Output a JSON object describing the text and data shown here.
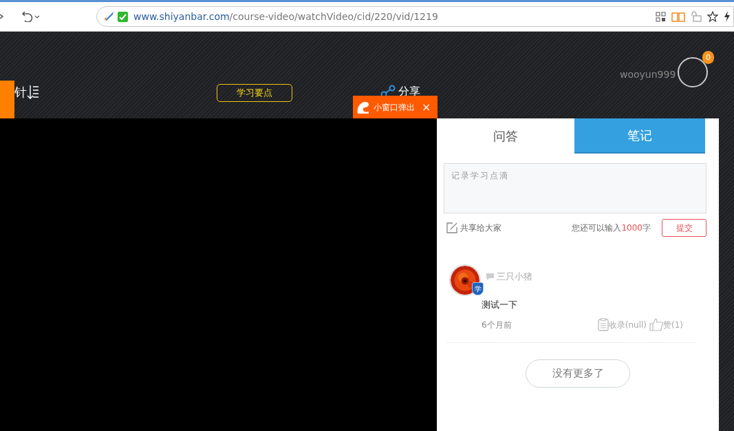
{
  "browser": {
    "url_domain": "www.shiyanbar.com",
    "url_path": "/course-video/watchVideo/cid/220/vid/1219"
  },
  "header": {
    "menu_label": "针",
    "key_points_button": "学习要点",
    "share_label": "分享",
    "username": "wooyun999",
    "notification_count": "0"
  },
  "popup": {
    "label": "小窗口弹出",
    "close": "×"
  },
  "tabs": [
    {
      "label": "问答",
      "selected": false
    },
    {
      "label": "笔记",
      "selected": true
    }
  ],
  "note_form": {
    "placeholder": "记录学习点滴",
    "share_label": "共享给大家",
    "remaining_prefix": "您还可以输入",
    "remaining_count": "1000",
    "remaining_suffix": "字",
    "submit": "提交"
  },
  "notes": [
    {
      "author": "三只小猪",
      "badge": "学",
      "text": "测试一下",
      "time": "6个月前",
      "collect": "收录(null)",
      "like": "赞(1)"
    }
  ],
  "no_more": "没有更多了"
}
